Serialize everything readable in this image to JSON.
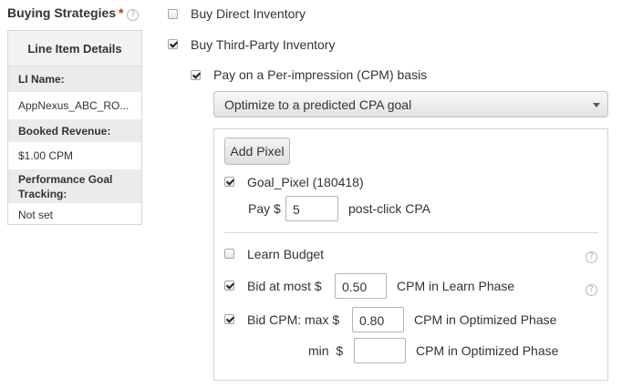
{
  "header": {
    "title": "Buying Strategies",
    "required_mark": "*",
    "help_glyph": "?"
  },
  "side_panel": {
    "title": "Line Item Details",
    "rows": [
      {
        "label": "LI Name:",
        "value": "AppNexus_ABC_RO..."
      },
      {
        "label": "Booked Revenue:",
        "value": "$1.00 CPM"
      },
      {
        "label": "Performance Goal Tracking:",
        "value": "Not set"
      }
    ]
  },
  "options": {
    "buy_direct": {
      "label": "Buy Direct Inventory",
      "checked": false
    },
    "buy_third_party": {
      "label": "Buy Third-Party Inventory",
      "checked": true
    },
    "pay_cpm": {
      "label": "Pay on a Per-impression (CPM) basis",
      "checked": true
    }
  },
  "optimize_select": {
    "value": "Optimize to a predicted CPA goal"
  },
  "pixel_section": {
    "add_pixel_label": "Add Pixel",
    "goal_pixel": {
      "label": "Goal_Pixel (180418)",
      "checked": true
    },
    "pay_label": "Pay $",
    "pay_value": "5",
    "pay_suffix": "post-click CPA"
  },
  "learn_budget": {
    "label": "Learn Budget",
    "checked": false
  },
  "bid_at_most": {
    "label": "Bid at most $",
    "value": "0.50",
    "suffix": "CPM in Learn Phase",
    "checked": true
  },
  "bid_cpm": {
    "label": "Bid CPM: max $",
    "max_value": "0.80",
    "max_suffix": "CPM in Optimized Phase",
    "min_label": "min  $",
    "min_value": "",
    "min_suffix": "CPM in Optimized Phase",
    "checked": true
  },
  "help_glyph": "?"
}
